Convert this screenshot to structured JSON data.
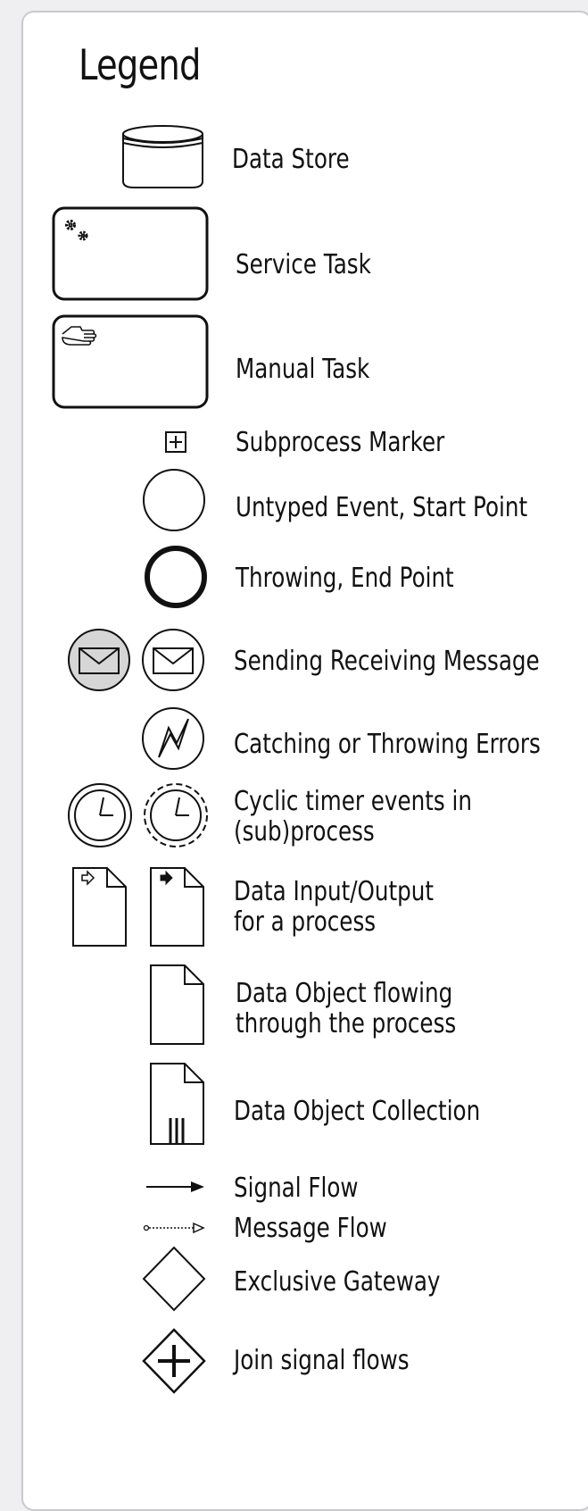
{
  "legend": {
    "title": "Legend",
    "items": {
      "data_store": "Data Store",
      "service_task": "Service Task",
      "manual_task": "Manual Task",
      "subprocess_marker": "Subprocess Marker",
      "untyped_event": "Untyped Event, Start Point",
      "throwing_end": "Throwing, End Point",
      "message": "Sending Receiving Message",
      "errors": "Catching or Throwing Errors",
      "cyclic_timer": "Cyclic timer events in\n(sub)process",
      "data_io": "Data Input/Output\nfor a process",
      "data_object": "Data Object flowing\nthrough the process",
      "data_collection": "Data Object Collection",
      "signal_flow": "Signal Flow",
      "message_flow": "Message Flow",
      "exclusive_gateway": "Exclusive Gateway",
      "join_flows": "Join signal flows"
    }
  },
  "colors": {
    "stroke": "#111111",
    "message_fill": "#d6d6d6",
    "panel_bg": "#ffffff",
    "page_bg": "#efeff1"
  }
}
